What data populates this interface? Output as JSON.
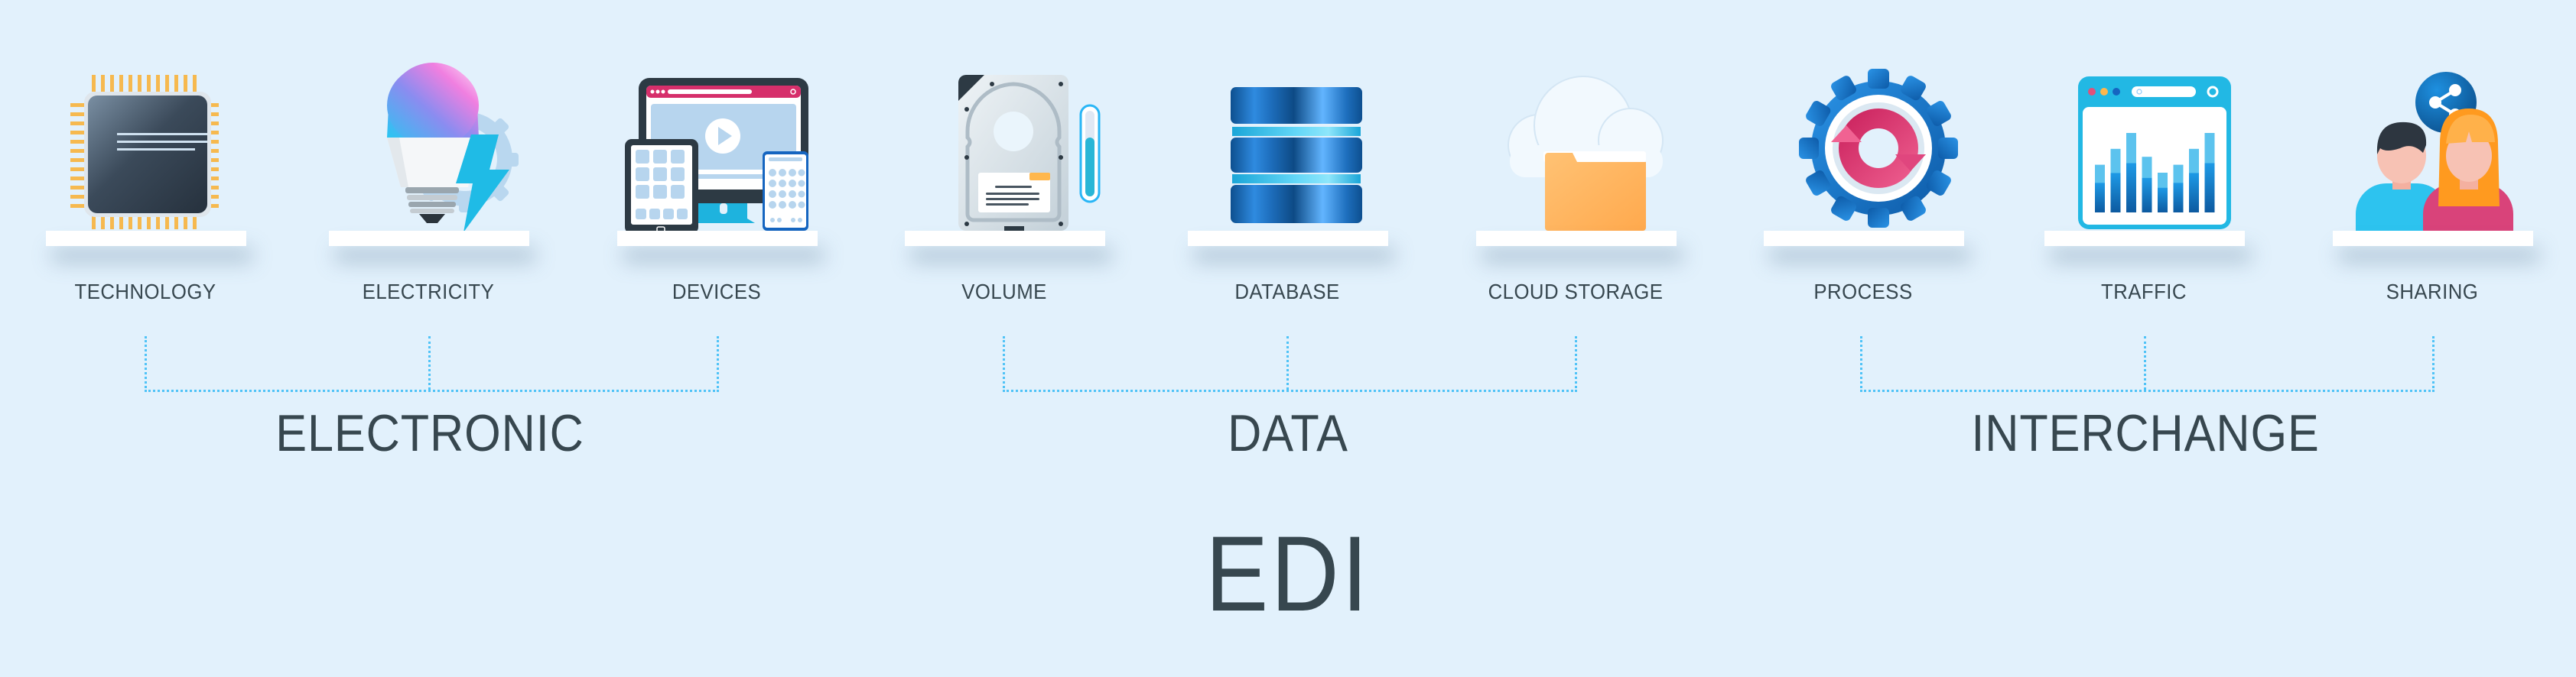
{
  "title": "EDI",
  "groups": [
    {
      "label": "ELECTRONIC",
      "items": [
        "TECHNOLOGY",
        "ELECTRICITY",
        "DEVICES"
      ]
    },
    {
      "label": "DATA",
      "items": [
        "VOLUME",
        "DATABASE",
        "CLOUD STORAGE"
      ]
    },
    {
      "label": "INTERCHANGE",
      "items": [
        "PROCESS",
        "TRAFFIC",
        "SHARING"
      ]
    }
  ],
  "items": [
    {
      "label": "TECHNOLOGY",
      "icon": "microchip-icon"
    },
    {
      "label": "ELECTRICITY",
      "icon": "smart-bulb-lightning-gear-icon"
    },
    {
      "label": "DEVICES",
      "icon": "monitor-tablet-phone-icon"
    },
    {
      "label": "VOLUME",
      "icon": "hard-drive-level-icon"
    },
    {
      "label": "DATABASE",
      "icon": "database-stack-icon"
    },
    {
      "label": "CLOUD STORAGE",
      "icon": "cloud-folder-icon"
    },
    {
      "label": "PROCESS",
      "icon": "gear-refresh-icon"
    },
    {
      "label": "TRAFFIC",
      "icon": "browser-bar-chart-icon"
    },
    {
      "label": "SHARING",
      "icon": "people-share-icon"
    }
  ],
  "colors": {
    "background": "#e2f1fc",
    "text": "#37474f",
    "bracket": "#4fc3f7",
    "blue": "#1e88e5",
    "pink": "#d81b60",
    "orange": "#ffb74d",
    "cyan": "#29b6f6"
  }
}
